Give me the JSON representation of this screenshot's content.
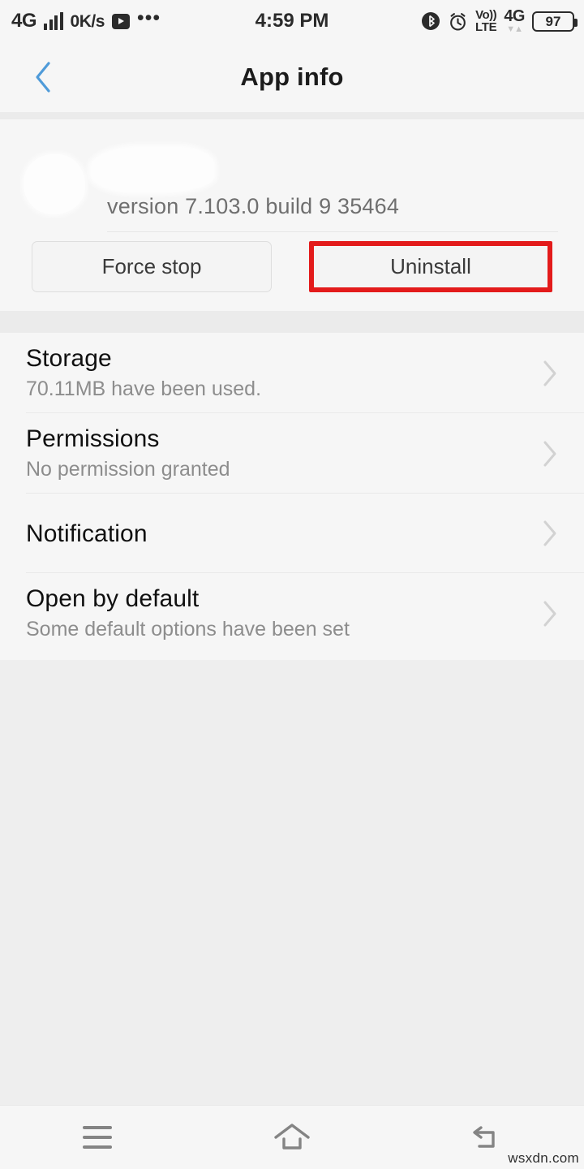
{
  "status_bar": {
    "network_type": "4G",
    "data_speed": "0K/s",
    "media_icon": "play-icon",
    "overflow_icon": "more-dots-icon",
    "clock": "4:59 PM",
    "bluetooth_icon": "bluetooth-icon",
    "alarm_icon": "alarm-clock-icon",
    "volte_top": "Vo))",
    "volte_bottom": "LTE",
    "sim_network": "4G",
    "data_arrows": "▼▲",
    "battery_level": "97"
  },
  "title_bar": {
    "back_icon": "back-chevron-icon",
    "title": "App info"
  },
  "app_header": {
    "icon": "app-icon-redacted",
    "name": "",
    "version": "version 7.103.0 build 9 35464"
  },
  "actions": {
    "force_stop_label": "Force stop",
    "uninstall_label": "Uninstall",
    "highlight_color": "#e31b1b",
    "highlight_target": "uninstall-button"
  },
  "settings_list": [
    {
      "title": "Storage",
      "subtitle": "70.11MB have been used.",
      "chevron": "chevron-right-icon"
    },
    {
      "title": "Permissions",
      "subtitle": "No permission granted",
      "chevron": "chevron-right-icon"
    },
    {
      "title": "Notification",
      "subtitle": "",
      "chevron": "chevron-right-icon"
    },
    {
      "title": "Open by default",
      "subtitle": "Some default options have been set",
      "chevron": "chevron-right-icon"
    }
  ],
  "nav_bar": {
    "menu_icon": "menu-recents-icon",
    "home_icon": "home-icon",
    "back_icon": "back-arrow-icon"
  },
  "watermark": "wsxdn.com",
  "colors": {
    "accent_blue": "#4f9bd9",
    "highlight_red": "#e31b1b",
    "card_bg": "#f6f6f6",
    "page_bg": "#eeeeee",
    "title_text": "#1c1c1c",
    "subtitle_text": "#8d8d8d"
  }
}
